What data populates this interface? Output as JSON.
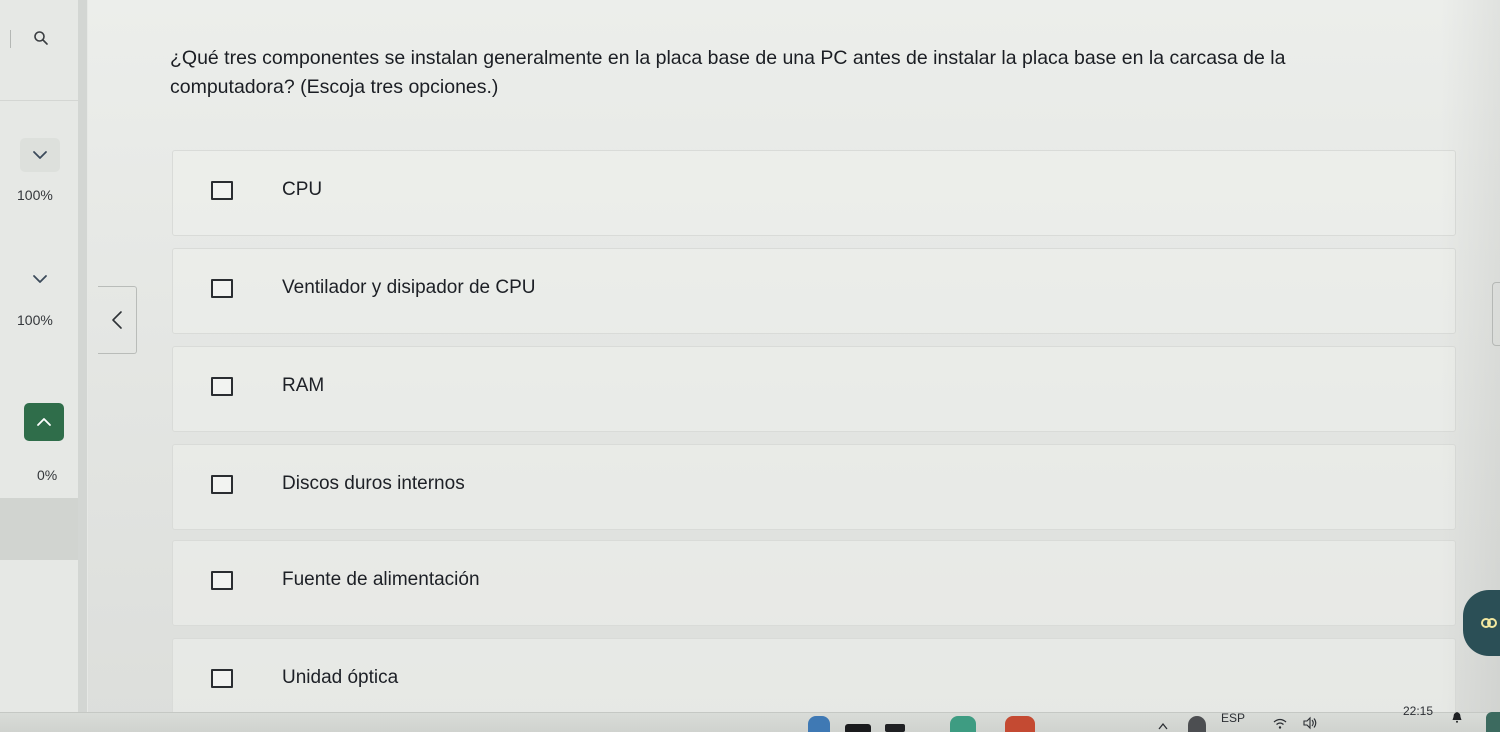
{
  "question": {
    "text": "¿Qué tres componentes se instalan generalmente en la placa base de una PC antes de instalar la placa base en la carcasa de la computadora? (Escoja tres opciones.)"
  },
  "options": [
    {
      "label": "CPU",
      "checked": false
    },
    {
      "label": "Ventilador y disipador de CPU",
      "checked": false
    },
    {
      "label": "RAM",
      "checked": false
    },
    {
      "label": "Discos duros internos",
      "checked": false
    },
    {
      "label": "Fuente de alimentación",
      "checked": false
    },
    {
      "label": "Unidad óptica",
      "checked": false
    }
  ],
  "sidebar": {
    "sections": [
      {
        "progress": "100%",
        "toggle_icon": "chevron-down-icon"
      },
      {
        "progress": "100%",
        "toggle_icon": "chevron-down-icon"
      },
      {
        "progress": "0%",
        "toggle_icon": "chevron-up-icon",
        "active": true
      }
    ],
    "search_icon": "search-icon",
    "collapse_icon": "chevron-left-icon"
  },
  "taskbar": {
    "language": "ESP",
    "time": "22:15"
  },
  "colors": {
    "active_section": "#2f6d4a",
    "text": "#1d2026"
  }
}
